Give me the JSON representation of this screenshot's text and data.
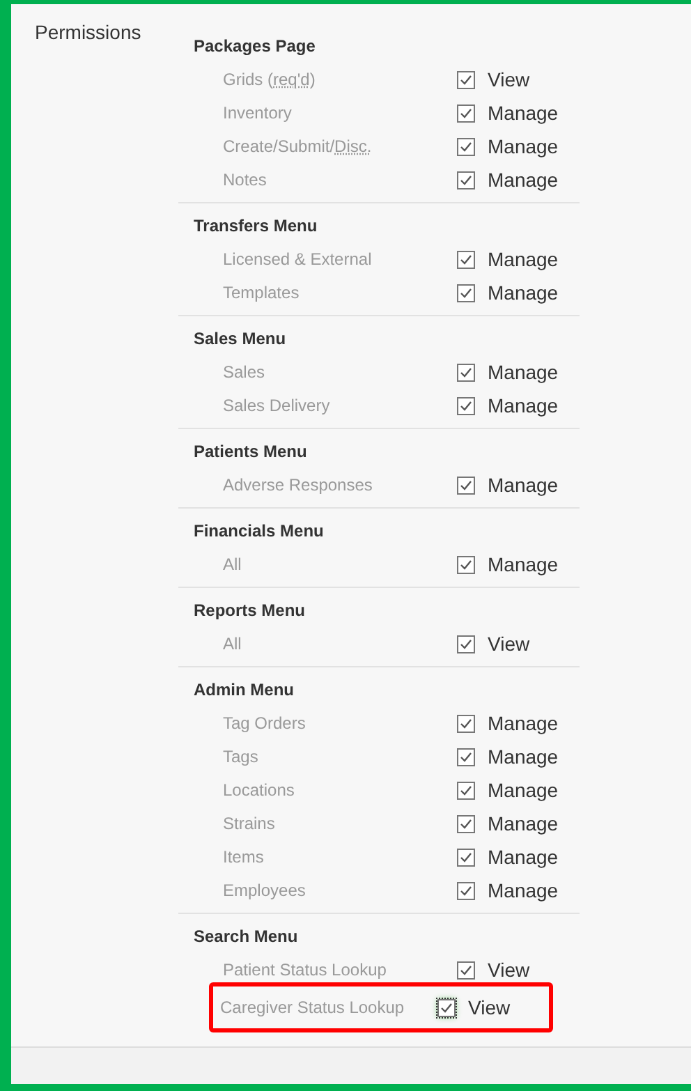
{
  "field_label": "Permissions",
  "groups": [
    {
      "title": "Packages Page",
      "items": [
        {
          "label_parts": [
            {
              "text": "Grids ("
            },
            {
              "text": "req'd",
              "abbr": true
            },
            {
              "text": ")"
            }
          ],
          "checked": true,
          "action": "View",
          "focused": false
        },
        {
          "label_parts": [
            {
              "text": "Inventory"
            }
          ],
          "checked": true,
          "action": "Manage",
          "focused": false
        },
        {
          "label_parts": [
            {
              "text": "Create/Submit/"
            },
            {
              "text": "Disc.",
              "abbr": true
            }
          ],
          "checked": true,
          "action": "Manage",
          "focused": false
        },
        {
          "label_parts": [
            {
              "text": "Notes"
            }
          ],
          "checked": true,
          "action": "Manage",
          "focused": false
        }
      ]
    },
    {
      "title": "Transfers Menu",
      "items": [
        {
          "label_parts": [
            {
              "text": "Licensed & External"
            }
          ],
          "checked": true,
          "action": "Manage",
          "focused": false
        },
        {
          "label_parts": [
            {
              "text": "Templates"
            }
          ],
          "checked": true,
          "action": "Manage",
          "focused": false
        }
      ]
    },
    {
      "title": "Sales Menu",
      "items": [
        {
          "label_parts": [
            {
              "text": "Sales"
            }
          ],
          "checked": true,
          "action": "Manage",
          "focused": false
        },
        {
          "label_parts": [
            {
              "text": "Sales Delivery"
            }
          ],
          "checked": true,
          "action": "Manage",
          "focused": false
        }
      ]
    },
    {
      "title": "Patients Menu",
      "items": [
        {
          "label_parts": [
            {
              "text": "Adverse Responses"
            }
          ],
          "checked": true,
          "action": "Manage",
          "focused": false
        }
      ]
    },
    {
      "title": "Financials Menu",
      "items": [
        {
          "label_parts": [
            {
              "text": "All"
            }
          ],
          "checked": true,
          "action": "Manage",
          "focused": false
        }
      ]
    },
    {
      "title": "Reports Menu",
      "items": [
        {
          "label_parts": [
            {
              "text": "All"
            }
          ],
          "checked": true,
          "action": "View",
          "focused": false
        }
      ]
    },
    {
      "title": "Admin Menu",
      "items": [
        {
          "label_parts": [
            {
              "text": "Tag Orders"
            }
          ],
          "checked": true,
          "action": "Manage",
          "focused": false
        },
        {
          "label_parts": [
            {
              "text": "Tags"
            }
          ],
          "checked": true,
          "action": "Manage",
          "focused": false
        },
        {
          "label_parts": [
            {
              "text": "Locations"
            }
          ],
          "checked": true,
          "action": "Manage",
          "focused": false
        },
        {
          "label_parts": [
            {
              "text": "Strains"
            }
          ],
          "checked": true,
          "action": "Manage",
          "focused": false
        },
        {
          "label_parts": [
            {
              "text": "Items"
            }
          ],
          "checked": true,
          "action": "Manage",
          "focused": false
        },
        {
          "label_parts": [
            {
              "text": "Employees"
            }
          ],
          "checked": true,
          "action": "Manage",
          "focused": false
        }
      ]
    },
    {
      "title": "Search Menu",
      "items": [
        {
          "label_parts": [
            {
              "text": "Patient Status Lookup"
            }
          ],
          "checked": true,
          "action": "View",
          "focused": false
        },
        {
          "label_parts": [
            {
              "text": "Caregiver Status Lookup"
            }
          ],
          "checked": true,
          "action": "View",
          "focused": true,
          "highlighted": true
        }
      ]
    }
  ]
}
